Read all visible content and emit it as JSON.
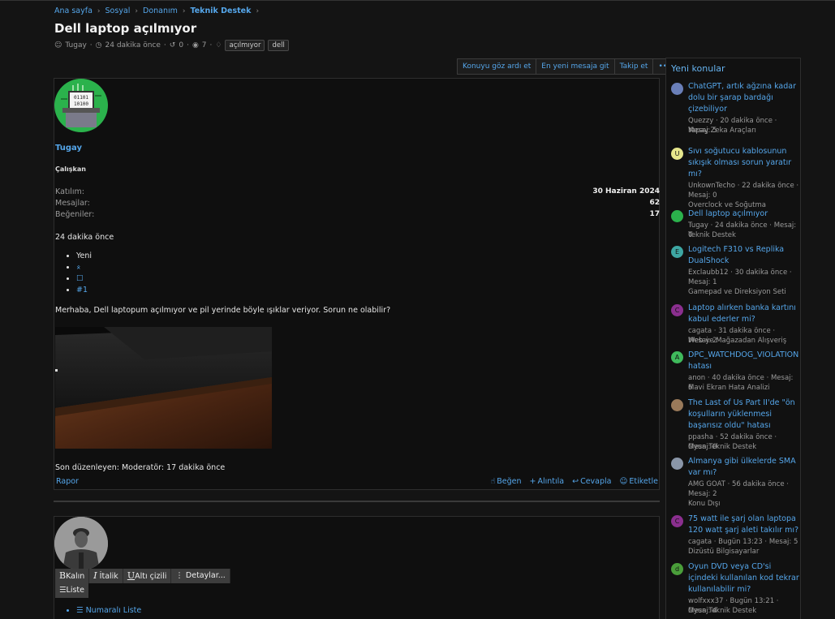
{
  "breadcrumb": [
    "Ana sayfa",
    "Sosyal",
    "Donanım",
    "Teknik Destek"
  ],
  "thread": {
    "title": "Dell laptop açılmıyor",
    "author": "Tugay",
    "time": "24 dakika önce",
    "replies": "0",
    "views": "7",
    "tags": [
      "açılmıyor",
      "dell"
    ]
  },
  "thread_actions": [
    "Konuyu göz ardı et",
    "En yeni mesaja git",
    "Takip et",
    "•••"
  ],
  "post": {
    "username": "Tugay",
    "user_title": "Çalışkan",
    "stats": [
      {
        "k": "Katılım:",
        "v": "30 Haziran 2024"
      },
      {
        "k": "Mesajlar:",
        "v": "62"
      },
      {
        "k": "Beğeniler:",
        "v": "17"
      }
    ],
    "posted": "24 dakika önce",
    "list_new": "Yeni",
    "list_number": "#1",
    "message": "Merhaba, Dell laptopum açılmıyor ve pil yerinde böyle ışıklar veriyor. Sorun ne olabilir?",
    "edited": "Son düzenleyen: Moderatör: 17 dakika önce",
    "report": "Rapor",
    "actions": [
      "Beğen",
      "Alıntıla",
      "Cevapla",
      "Etiketle"
    ]
  },
  "editor": {
    "bold": "Kalın",
    "italic": "İtalik",
    "underline": "Altı çizili",
    "details": "Detaylar...",
    "list": "Liste",
    "numbered": "Numaralı Liste"
  },
  "sidebar": {
    "heading": "Yeni konular",
    "items": [
      {
        "title": "ChatGPT, artık ağzına kadar dolu bir şarap bardağı çizebiliyor",
        "meta": "Quezzy · 20 dakika önce · Mesaj: 5",
        "forum": "Yapay Zeka Araçları",
        "avatar": "",
        "color": "#6a7fb8"
      },
      {
        "title": "Sıvı soğutucu kablosunun sıkışık olması sorun yaratır mı?",
        "meta": "UnkownTecho · 22 dakika önce · Mesaj: 0",
        "forum": "Overclock ve Soğutma",
        "avatar": "U",
        "color": "#e6e68c"
      },
      {
        "title": "Dell laptop açılmıyor",
        "meta": "Tugay · 24 dakika önce · Mesaj: 0",
        "forum": "Teknik Destek",
        "avatar": "",
        "color": "#2bb24c"
      },
      {
        "title": "Logitech F310 vs Replika DualShock",
        "meta": "Exclaubb12 · 30 dakika önce · Mesaj: 1",
        "forum": "Gamepad ve Direksiyon Seti",
        "avatar": "E",
        "color": "#3ea7a3"
      },
      {
        "title": "Laptop alırken banka kartını kabul ederler mi?",
        "meta": "cagata · 31 dakika önce · Mesaj: 2",
        "forum": "Web ve Mağazadan Alışveriş",
        "avatar": "C",
        "color": "#8b2f8f"
      },
      {
        "title": "DPC_WATCHDOG_VIOLATION hatası",
        "meta": "anon · 40 dakika önce · Mesaj: 6",
        "forum": "Mavi Ekran Hata Analizi",
        "avatar": "A",
        "color": "#3fba5c"
      },
      {
        "title": "The Last of Us Part II'de \"ön koşulların yüklenmesi başarısız oldu\" hatası",
        "meta": "ppasha · 52 dakika önce · Mesaj: 0",
        "forum": "Oyun Teknik Destek",
        "avatar": "",
        "color": "#9a7a5a"
      },
      {
        "title": "Almanya gibi ülkelerde SMA var mı?",
        "meta": "AMG GOAT · 56 dakika önce · Mesaj: 2",
        "forum": "Konu Dışı",
        "avatar": "",
        "color": "#8a96a8"
      },
      {
        "title": "75 watt ile şarj olan laptopa 120 watt şarj aleti takılır mı?",
        "meta": "cagata · Bugün 13:23 · Mesaj: 5",
        "forum": "Dizüstü Bilgisayarlar",
        "avatar": "C",
        "color": "#8b2f8f"
      },
      {
        "title": "Oyun DVD veya CD'si içindeki kullanılan kod tekrar kullanılabilir mi?",
        "meta": "wolfxxx37 · Bugün 13:21 · Mesaj: 4",
        "forum": "Oyun Teknik Destek",
        "avatar": "d",
        "color": "#4a9e3a"
      }
    ]
  }
}
